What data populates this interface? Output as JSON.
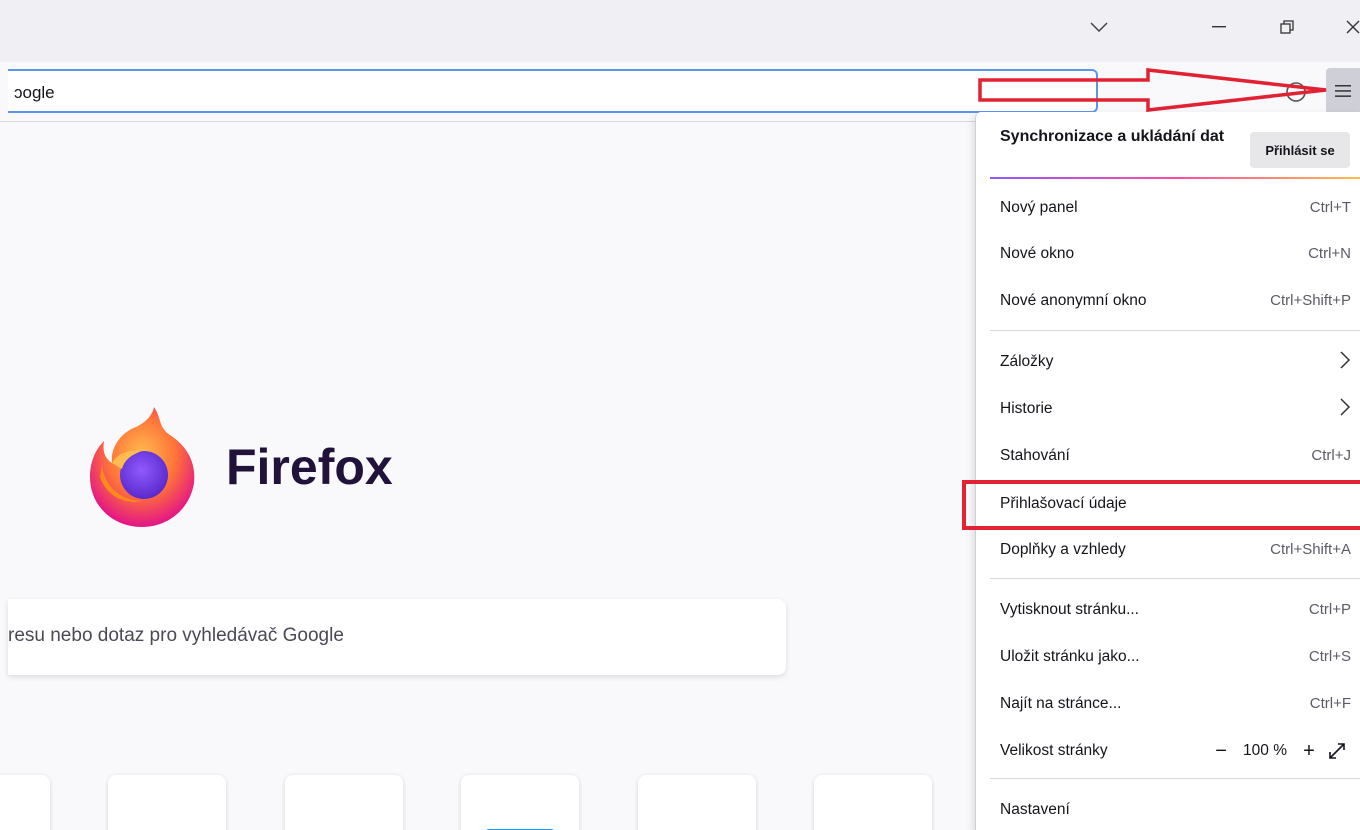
{
  "toolbar": {
    "url_text": "ɔogle",
    "icons": [
      "chevron-down-icon",
      "minimize-icon",
      "restore-icon",
      "close-icon",
      "shield-icon",
      "hamburger-menu-icon"
    ]
  },
  "newtab": {
    "brand": "Firefox",
    "search_placeholder": "resu nebo dotaz pro vyhledávač Google"
  },
  "menu": {
    "sync_label": "Synchronizace a ukládání dat",
    "signin_label": "Přihlásit se",
    "items": [
      {
        "label": "Nový panel",
        "shortcut": "Ctrl+T"
      },
      {
        "label": "Nové okno",
        "shortcut": "Ctrl+N"
      },
      {
        "label": "Nové anonymní okno",
        "shortcut": "Ctrl+Shift+P"
      },
      {
        "label": "Záložky",
        "shortcut": ""
      },
      {
        "label": "Historie",
        "shortcut": ""
      },
      {
        "label": "Stahování",
        "shortcut": "Ctrl+J"
      },
      {
        "label": "Přihlašovací údaje",
        "shortcut": ""
      },
      {
        "label": "Doplňky a vzhledy",
        "shortcut": "Ctrl+Shift+A"
      },
      {
        "label": "Vytisknout stránku...",
        "shortcut": "Ctrl+P"
      },
      {
        "label": "Uložit stránku jako...",
        "shortcut": "Ctrl+S"
      },
      {
        "label": "Najít na stránce...",
        "shortcut": "Ctrl+F"
      },
      {
        "label": "Velikost stránky",
        "shortcut": ""
      },
      {
        "label": "Nastavení",
        "shortcut": ""
      }
    ],
    "zoom": {
      "minus": "−",
      "value": "100 %",
      "plus": "+"
    }
  },
  "colors": {
    "accent": "#5d94ee",
    "annotation": "#e02232",
    "firefox_text": "#20123a"
  }
}
